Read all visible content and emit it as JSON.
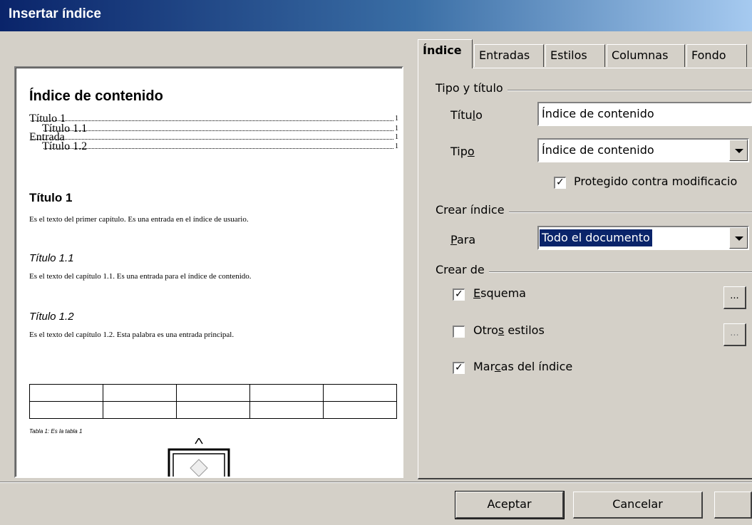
{
  "window": {
    "title": "Insertar índice"
  },
  "preview": {
    "heading": "Índice de contenido",
    "toc": [
      {
        "label": "Título 1",
        "page": "1",
        "indent": false
      },
      {
        "label": "Título 1.1",
        "page": "1",
        "indent": true
      },
      {
        "label": "Entrada",
        "page": "1",
        "indent": false
      },
      {
        "label": "Título 1.2",
        "page": "1",
        "indent": true
      }
    ],
    "h1": "Título 1",
    "p1": "Es el texto del primer capítulo. Es una entrada en el índice de usuario.",
    "h11": "Título 1.1",
    "p11": "Es el texto del capítulo 1.1. Es una entrada para el índice de contenido.",
    "h12": "Título 1.2",
    "p12": "Es el texto del capítulo 1.2. Esta palabra es una entrada principal.",
    "table_caption": "Tabla 1: Es la tabla 1"
  },
  "tabs": [
    "Índice",
    "Entradas",
    "Estilos",
    "Columnas",
    "Fondo"
  ],
  "type_title": {
    "group": "Tipo y título",
    "title_label_pre": "Títu",
    "title_label_u": "l",
    "title_label_post": "o",
    "title_value": "Índice de contenido",
    "type_label_pre": "Tip",
    "type_label_u": "o",
    "type_label_post": "",
    "type_value": "Índice de contenido",
    "protected_label": "Protegido contra modificacio",
    "protected_checked": true
  },
  "create_index": {
    "group": "Crear índice",
    "for_label_u": "P",
    "for_label_post": "ara",
    "for_value": "Todo el documento"
  },
  "create_from": {
    "group": "Crear de",
    "outline_u": "E",
    "outline_post": "squema",
    "outline_checked": true,
    "other_pre": "Otro",
    "other_u": "s",
    "other_post": " estilos",
    "other_checked": false,
    "marks_pre": "Mar",
    "marks_u": "c",
    "marks_post": "as del índice",
    "marks_checked": true,
    "dots": "..."
  },
  "buttons": {
    "ok": "Aceptar",
    "cancel": "Cancelar"
  }
}
